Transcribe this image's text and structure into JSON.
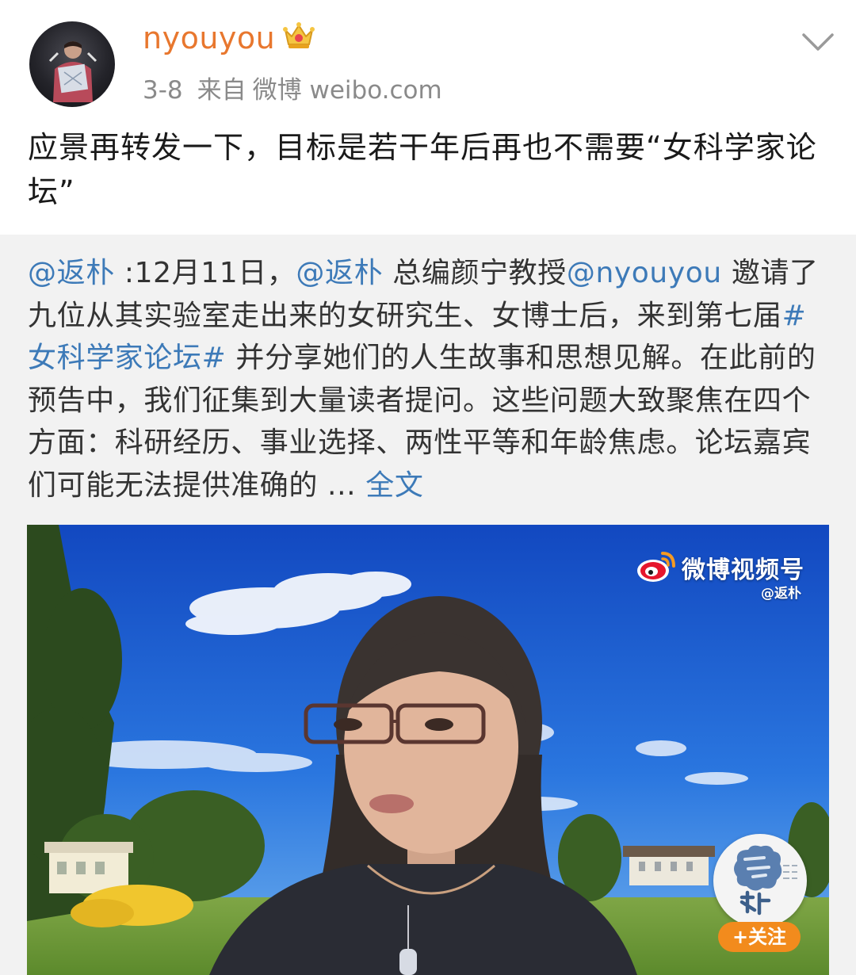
{
  "post": {
    "username": "nyouyou",
    "date": "3-8",
    "source_prefix": "来自",
    "source_app": "微博 weibo.com",
    "text": "应景再转发一下，目标是若干年后再也不需要“女科学家论坛”"
  },
  "repost": {
    "mention_author": "@返朴",
    "t1": " :12月11日，",
    "mention_fanpu": "@返朴",
    "t2": " 总编颜宁教授",
    "mention_nyouyou": "@nyouyou",
    "t3": " 邀请了九位从其实验室走出来的女研究生、女博士后，来到第七届",
    "hashtag": "#女科学家论坛#",
    "t4": " 并分享她们的人生故事和思想见解。在此前的预告中，我们征集到大量读者提问。这些问题大致聚焦在四个方面：科研经历、事业选择、两性平等和年龄焦虑。论坛嘉宾们可能无法提供准确的 ... ",
    "full_text_link": "全文"
  },
  "video": {
    "watermark_title": "微博视频号",
    "watermark_handle": "@返朴",
    "follow_button": "+关注"
  },
  "colors": {
    "username": "#e8772e",
    "link": "#3d7ab8",
    "meta": "#8a8a8a",
    "repost_bg": "#f2f2f2",
    "follow_bg": "#f28b1d"
  },
  "icons": [
    "avatar",
    "crown-icon",
    "chevron-down-icon",
    "weibo-logo-icon",
    "fanpu-logo-icon"
  ]
}
